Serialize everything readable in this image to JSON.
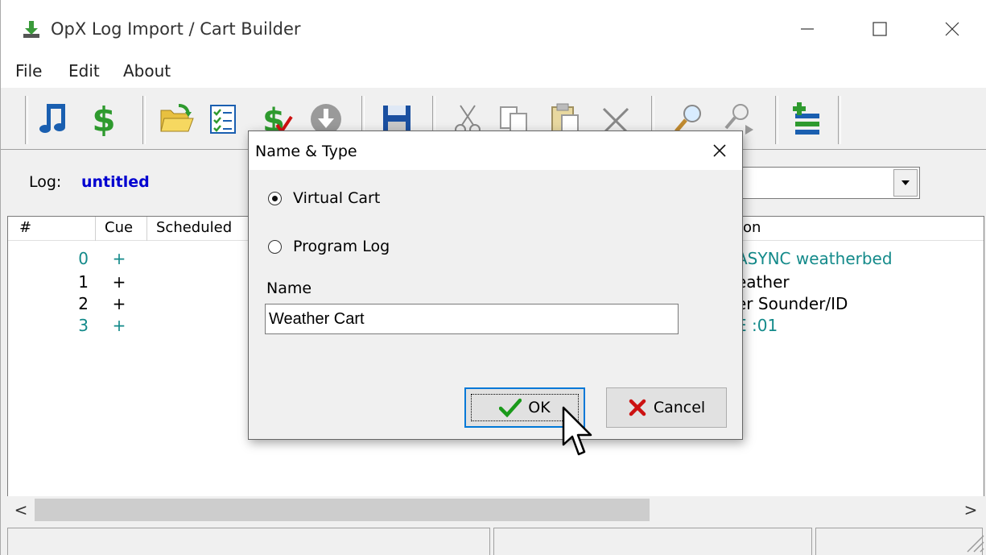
{
  "window": {
    "title": "OpX Log Import / Cart Builder",
    "controls": {
      "minimize": "—",
      "maximize": "☐",
      "close": "✕"
    }
  },
  "menu": {
    "items": [
      {
        "label": "File"
      },
      {
        "label": "Edit"
      },
      {
        "label": "About"
      }
    ]
  },
  "toolbar": {
    "buttons": [
      {
        "icon": "music-notes-icon"
      },
      {
        "icon": "money-icon"
      },
      {
        "icon": "open-folder-icon"
      },
      {
        "icon": "checklist-icon"
      },
      {
        "icon": "money-check-icon"
      },
      {
        "icon": "download-circle-icon"
      },
      {
        "icon": "save-icon"
      },
      {
        "icon": "cut-icon"
      },
      {
        "icon": "copy-icon"
      },
      {
        "icon": "paste-icon"
      },
      {
        "icon": "delete-icon"
      },
      {
        "icon": "find-icon"
      },
      {
        "icon": "find-next-icon"
      },
      {
        "icon": "add-list-icon"
      }
    ]
  },
  "log": {
    "label": "Log:",
    "name": "untitled"
  },
  "list": {
    "columns": [
      "#",
      "Cue",
      "Scheduled",
      "ion"
    ],
    "rows": [
      {
        "num": "0",
        "cue": "+",
        "desc": "ASYNC weatherbed",
        "color": "#138a8a"
      },
      {
        "num": "1",
        "cue": "+",
        "desc": "eather",
        "color": "#000000"
      },
      {
        "num": "2",
        "cue": "+",
        "desc": "er Sounder/ID",
        "color": "#000000"
      },
      {
        "num": "3",
        "cue": "+",
        "desc": "E :01",
        "color": "#138a8a"
      }
    ]
  },
  "scrollbar": {
    "left": "<",
    "right": ">"
  },
  "dialog": {
    "title": "Name & Type",
    "options": [
      {
        "label": "Virtual Cart",
        "selected": true
      },
      {
        "label": "Program Log",
        "selected": false
      }
    ],
    "name_label": "Name",
    "name_value": "Weather Cart",
    "ok_label": "OK",
    "cancel_label": "Cancel"
  },
  "colors": {
    "log_name": "#0000d0",
    "teal_row": "#138a8a",
    "ok_check": "#1a9a1a",
    "cancel_x": "#cc1111"
  }
}
